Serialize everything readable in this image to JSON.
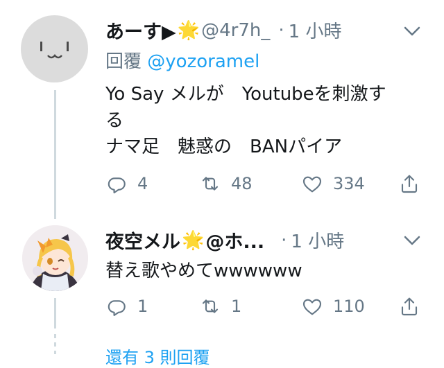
{
  "tweets": [
    {
      "display_name": "あーす▶",
      "name_emoji": "🌟",
      "handle": "@4r7h_",
      "separator": "·",
      "time": "1 小時",
      "reply_prefix": "回覆",
      "reply_mention": "@yozoramel",
      "body": [
        "Yo Say メルが　Youtubeを刺激す",
        "る",
        "ナマ足　魅惑の　BANパイア"
      ],
      "replies": "4",
      "retweets": "48",
      "likes": "334",
      "avatar_icon": "kaomoji-avatar"
    },
    {
      "display_name": "夜空メル",
      "name_emoji": "🌟",
      "handle": "@ホ...",
      "separator": "·",
      "time": "1 小時",
      "body": [
        "替え歌やめてwwwwww"
      ],
      "replies": "1",
      "retweets": "1",
      "likes": "110",
      "avatar_icon": "anime-girl-avatar"
    }
  ],
  "more_replies_link": "還有 3 則回覆",
  "colors": {
    "text": "#14171a",
    "muted": "#657786",
    "link": "#1da1f2",
    "thread": "#cfd9de"
  }
}
